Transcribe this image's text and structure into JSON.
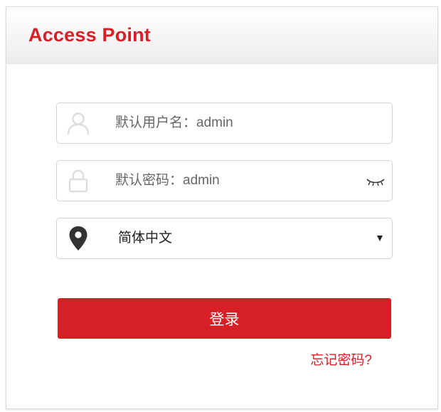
{
  "header": {
    "title": "Access Point"
  },
  "form": {
    "username": {
      "placeholder": "默认用户名：admin",
      "icon": "user-icon"
    },
    "password": {
      "placeholder": "默认密码：admin",
      "icon": "lock-icon",
      "toggle_icon": "eye-closed-icon"
    },
    "language": {
      "selected": "简体中文",
      "icon": "location-pin-icon"
    },
    "login_label": "登录",
    "forgot_label": "忘记密码?"
  },
  "colors": {
    "brand": "#d71f26",
    "icon_light": "#dddddd",
    "icon_dark": "#333333"
  }
}
